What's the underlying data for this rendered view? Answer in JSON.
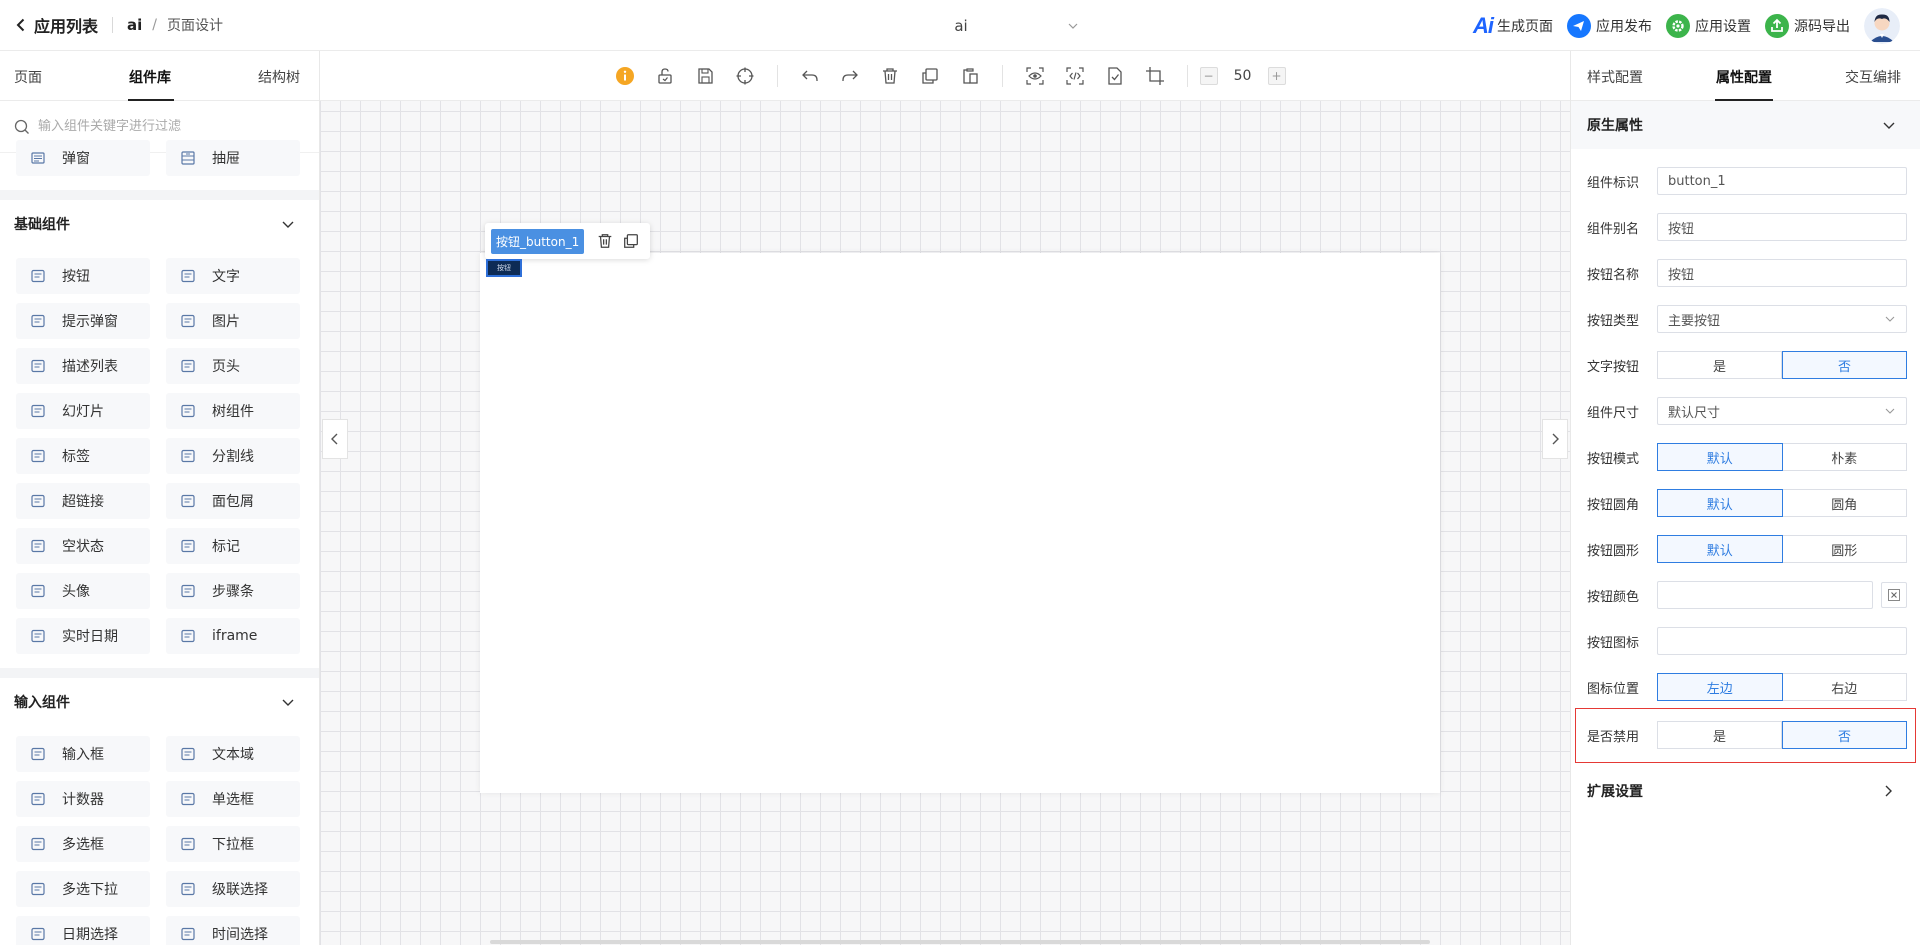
{
  "header": {
    "back_label": "应用列表",
    "crumb_app": "ai",
    "crumb_sep": "/",
    "crumb_page": "页面设计",
    "center_title": "ai",
    "actions": [
      {
        "label": "生成页面",
        "icon": "ai-icon"
      },
      {
        "label": "应用发布",
        "icon": "send-icon"
      },
      {
        "label": "应用设置",
        "icon": "settings-icon"
      },
      {
        "label": "源码导出",
        "icon": "export-icon"
      }
    ],
    "ai_logo_text": "Ai"
  },
  "left": {
    "tabs": [
      "页面",
      "组件库",
      "结构树"
    ],
    "active_tab": 1,
    "search_placeholder": "输入组件关键字进行过滤",
    "top_row": [
      {
        "label": "弹窗",
        "icon": "dialog-icon"
      },
      {
        "label": "抽屉",
        "icon": "drawer-icon"
      }
    ],
    "basic_title": "基础组件",
    "basic": [
      {
        "label": "按钮",
        "icon": "button-icon"
      },
      {
        "label": "文字",
        "icon": "text-icon"
      },
      {
        "label": "提示弹窗",
        "icon": "alert-dialog-icon"
      },
      {
        "label": "图片",
        "icon": "image-icon"
      },
      {
        "label": "描述列表",
        "icon": "description-list-icon"
      },
      {
        "label": "页头",
        "icon": "page-header-icon"
      },
      {
        "label": "幻灯片",
        "icon": "carousel-icon"
      },
      {
        "label": "树组件",
        "icon": "tree-icon"
      },
      {
        "label": "标签",
        "icon": "tag-icon"
      },
      {
        "label": "分割线",
        "icon": "divider-icon"
      },
      {
        "label": "超链接",
        "icon": "link-icon"
      },
      {
        "label": "面包屑",
        "icon": "breadcrumb-icon"
      },
      {
        "label": "空状态",
        "icon": "empty-icon"
      },
      {
        "label": "标记",
        "icon": "pin-icon"
      },
      {
        "label": "头像",
        "icon": "avatar-icon"
      },
      {
        "label": "步骤条",
        "icon": "steps-icon"
      },
      {
        "label": "实时日期",
        "icon": "calendar-icon"
      },
      {
        "label": "iframe",
        "icon": "iframe-icon"
      }
    ],
    "input_title": "输入组件",
    "inputs": [
      {
        "label": "输入框",
        "icon": "input-icon"
      },
      {
        "label": "文本域",
        "icon": "textarea-icon"
      },
      {
        "label": "计数器",
        "icon": "counter-icon"
      },
      {
        "label": "单选框",
        "icon": "radio-icon"
      },
      {
        "label": "多选框",
        "icon": "checkbox-icon"
      },
      {
        "label": "下拉框",
        "icon": "select-icon"
      },
      {
        "label": "多选下拉",
        "icon": "multi-select-icon"
      },
      {
        "label": "级联选择",
        "icon": "cascader-icon"
      },
      {
        "label": "日期选择",
        "icon": "date-picker-icon"
      },
      {
        "label": "时间选择",
        "icon": "time-picker-icon"
      }
    ]
  },
  "canvas": {
    "zoom_value": "50",
    "zoom_minus": "−",
    "zoom_plus": "+",
    "selected_tag": "按钮_button_1",
    "mini_button_label": "按钮"
  },
  "right": {
    "tabs": [
      "样式配置",
      "属性配置",
      "交互编排"
    ],
    "active_tab": 1,
    "native_title": "原生属性",
    "ext_title": "扩展设置",
    "props": {
      "id_label": "组件标识",
      "id_value": "button_1",
      "alias_label": "组件别名",
      "alias_value": "按钮",
      "name_label": "按钮名称",
      "name_value": "按钮",
      "type_label": "按钮类型",
      "type_value": "主要按钮",
      "textbtn_label": "文字按钮",
      "textbtn_opts": [
        "是",
        "否"
      ],
      "textbtn_on": 1,
      "size_label": "组件尺寸",
      "size_value": "默认尺寸",
      "mode_label": "按钮模式",
      "mode_opts": [
        "默认",
        "朴素"
      ],
      "mode_on": 0,
      "round_label": "按钮圆角",
      "round_opts": [
        "默认",
        "圆角"
      ],
      "round_on": 0,
      "circle_label": "按钮圆形",
      "circle_opts": [
        "默认",
        "圆形"
      ],
      "circle_on": 0,
      "color_label": "按钮颜色",
      "icon_label": "按钮图标",
      "iconpos_label": "图标位置",
      "iconpos_opts": [
        "左边",
        "右边"
      ],
      "iconpos_on": 0,
      "disabled_label": "是否禁用",
      "disabled_opts": [
        "是",
        "否"
      ],
      "disabled_on": 1
    }
  },
  "colors": {
    "accent": "#2f7de1",
    "highlight_border": "#e53935",
    "selected_tag_bg": "#4a90e2"
  }
}
